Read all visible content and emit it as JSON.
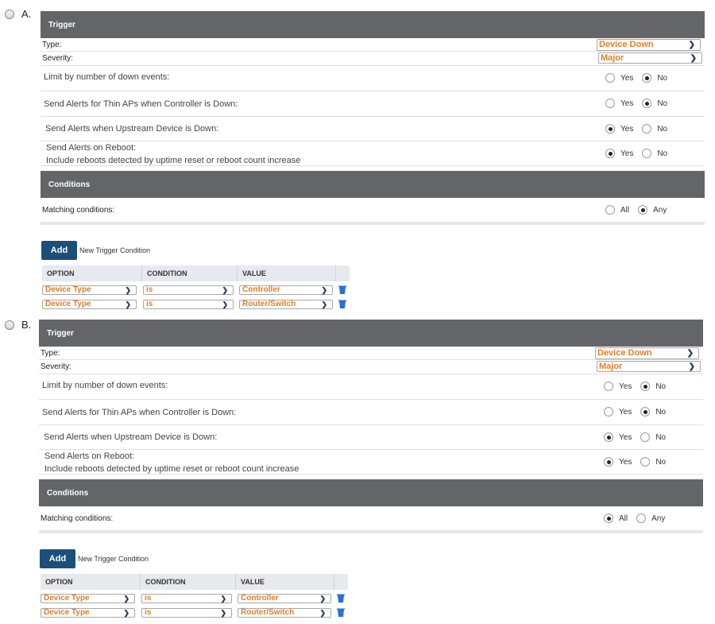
{
  "choices": [
    {
      "letter": "A.",
      "trigger": {
        "header": "Trigger",
        "type_label": "Type:",
        "type_value": "Device Down",
        "severity_label": "Severity:",
        "severity_value": "Major",
        "rows": [
          {
            "label": "Limit by number of down events:",
            "sub": "",
            "yes": "Yes",
            "no": "No",
            "selected": "No"
          },
          {
            "label": "Send Alerts for Thin APs when Controller is Down:",
            "sub": "",
            "yes": "Yes",
            "no": "No",
            "selected": "No"
          },
          {
            "label": "Send Alerts when Upstream Device is Down:",
            "sub": "",
            "yes": "Yes",
            "no": "No",
            "selected": "Yes"
          },
          {
            "label": "Send Alerts on Reboot:",
            "sub": "Include reboots detected by uptime reset or reboot count increase",
            "yes": "Yes",
            "no": "No",
            "selected": "Yes"
          }
        ]
      },
      "conditions": {
        "header": "Conditions",
        "matching_label": "Matching conditions:",
        "all": "All",
        "any": "Any",
        "selected": "Any",
        "add_button": "Add",
        "add_note": "New Trigger Condition",
        "columns": [
          "OPTION",
          "CONDITION",
          "VALUE"
        ],
        "rows": [
          {
            "option": "Device Type",
            "condition": "is",
            "value": "Controller"
          },
          {
            "option": "Device Type",
            "condition": "is",
            "value": "Router/Switch"
          }
        ]
      }
    },
    {
      "letter": "B.",
      "trigger": {
        "header": "Trigger",
        "type_label": "Type:",
        "type_value": "Device Down",
        "severity_label": "Severity:",
        "severity_value": "Major",
        "rows": [
          {
            "label": "Limit by number of down events:",
            "sub": "",
            "yes": "Yes",
            "no": "No",
            "selected": "No"
          },
          {
            "label": "Send Alerts for Thin APs when Controller is Down:",
            "sub": "",
            "yes": "Yes",
            "no": "No",
            "selected": "No"
          },
          {
            "label": "Send Alerts when Upstream Device is Down:",
            "sub": "",
            "yes": "Yes",
            "no": "No",
            "selected": "Yes"
          },
          {
            "label": "Send Alerts on Reboot:",
            "sub": "Include reboots detected by uptime reset or reboot count increase",
            "yes": "Yes",
            "no": "No",
            "selected": "Yes"
          }
        ]
      },
      "conditions": {
        "header": "Conditions",
        "matching_label": "Matching conditions:",
        "all": "All",
        "any": "Any",
        "selected": "All",
        "add_button": "Add",
        "add_note": "New Trigger Condition",
        "columns": [
          "OPTION",
          "CONDITION",
          "VALUE"
        ],
        "rows": [
          {
            "option": "Device Type",
            "condition": "is",
            "value": "Controller"
          },
          {
            "option": "Device Type",
            "condition": "is",
            "value": "Router/Switch"
          }
        ]
      }
    }
  ],
  "colors": {
    "header_bg": "#646569",
    "accent_orange": "#e87d1e",
    "add_button_bg": "#1c4f79",
    "trash_blue": "#2a6fd6"
  },
  "icons": {
    "select_arrow": "chevron-down-icon",
    "delete": "trash-icon",
    "choice": "radio-button"
  }
}
